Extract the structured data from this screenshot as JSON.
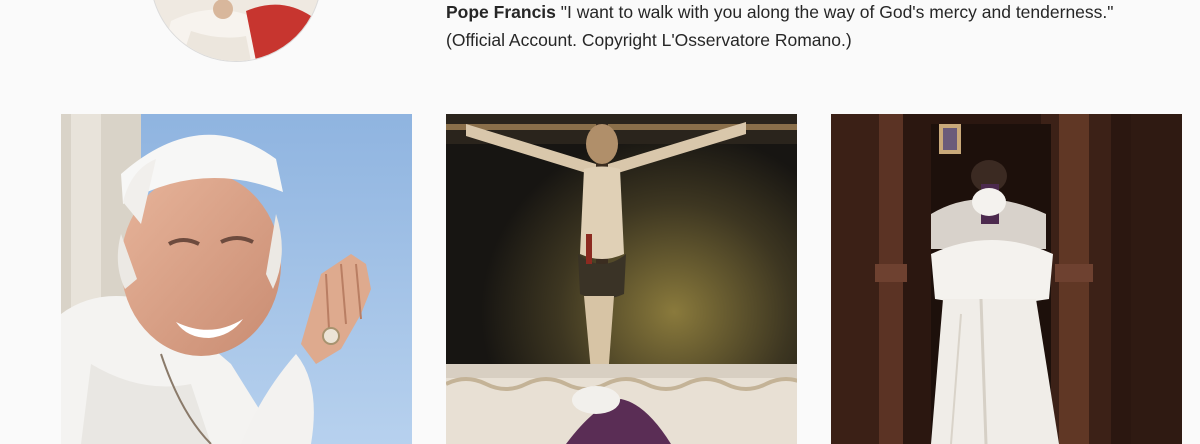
{
  "profile": {
    "name": "Pope Francis",
    "bio": " \"I want to walk with you along the way of God's mercy and tenderness.\" (Official Account. Copyright L'Osservatore Romano.)"
  },
  "posts": [
    {
      "subject": "pope-waving-photo"
    },
    {
      "subject": "crucifix-prayer-photo"
    },
    {
      "subject": "confessional-photo"
    }
  ],
  "colors": {
    "page_background": "#fafafa",
    "text": "#262626"
  }
}
